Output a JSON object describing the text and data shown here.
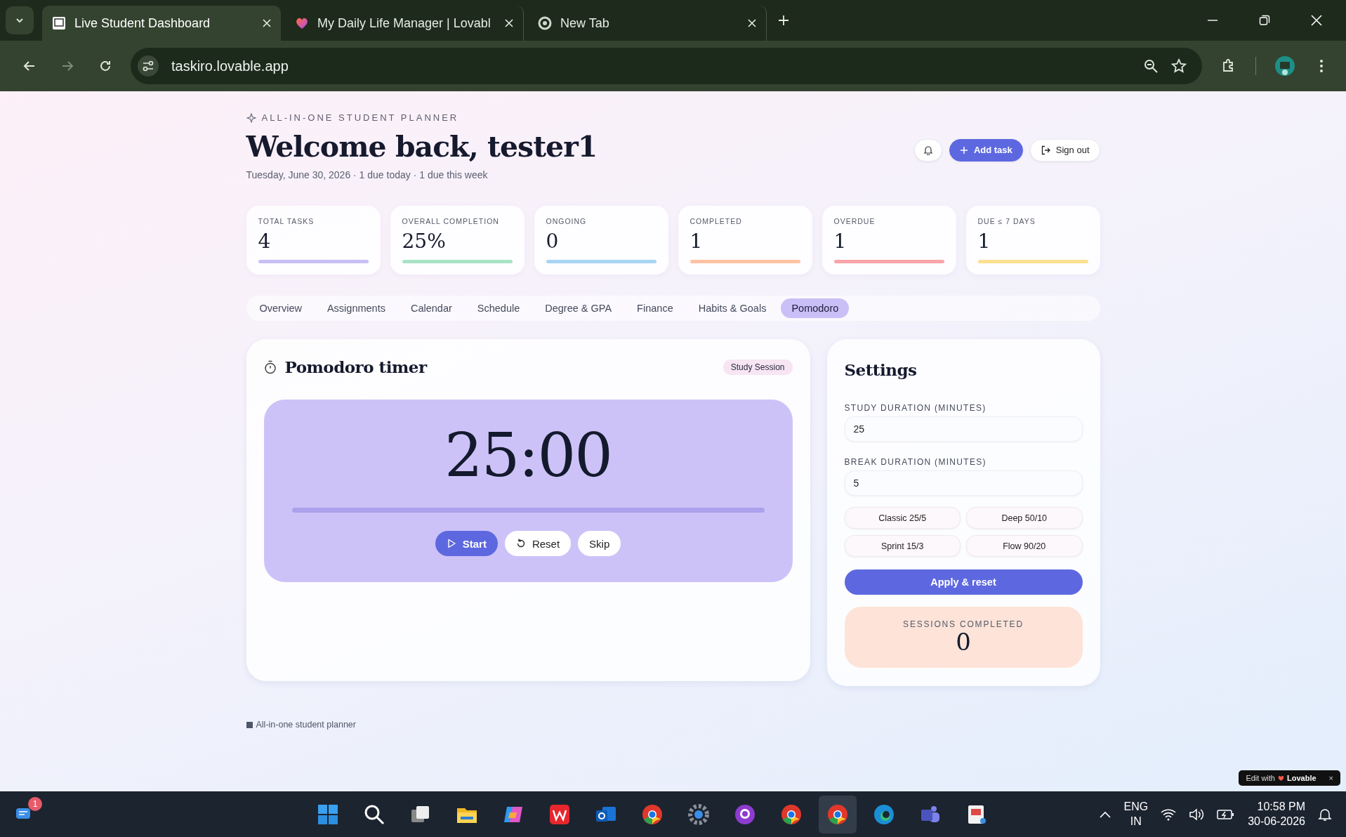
{
  "browser": {
    "tabs": [
      {
        "title": "Live Student Dashboard",
        "selected": true
      },
      {
        "title": "My Daily Life Manager | Lovabl",
        "selected": false
      },
      {
        "title": "New Tab",
        "selected": false
      }
    ],
    "url": "taskiro.lovable.app"
  },
  "header": {
    "eyebrow": "ALL-IN-ONE STUDENT PLANNER",
    "title": "Welcome back, tester1",
    "subtitle": "Tuesday, June 30, 2026 · 1 due today · 1 due this week",
    "buttons": [
      {
        "kind": "icon"
      },
      {
        "kind": "primary",
        "label": "Add task"
      },
      {
        "kind": "secondary",
        "label": "Sign out"
      }
    ]
  },
  "stats": [
    {
      "label": "TOTAL TASKS",
      "value": "4",
      "color": "#c9bff5"
    },
    {
      "label": "OVERALL COMPLETION",
      "value": "25%",
      "color": "#a8e3c5"
    },
    {
      "label": "ONGOING",
      "value": "0",
      "color": "#a9d5f5"
    },
    {
      "label": "COMPLETED",
      "value": "1",
      "color": "#ffc3a3"
    },
    {
      "label": "OVERDUE",
      "value": "1",
      "color": "#f8a4a8"
    },
    {
      "label": "DUE ≤ 7 DAYS",
      "value": "1",
      "color": "#fbe08f"
    }
  ],
  "nav_tabs": [
    {
      "label": "Overview",
      "selected": false
    },
    {
      "label": "Assignments",
      "selected": false
    },
    {
      "label": "Calendar",
      "selected": false
    },
    {
      "label": "Schedule",
      "selected": false
    },
    {
      "label": "Degree & GPA",
      "selected": false
    },
    {
      "label": "Finance",
      "selected": false
    },
    {
      "label": "Habits & Goals",
      "selected": false
    },
    {
      "label": "Pomodoro",
      "selected": true
    }
  ],
  "timer": {
    "title": "Pomodoro timer",
    "badge": "Study Session",
    "time": "25:00",
    "buttons": [
      {
        "kind": "primary",
        "label": "Start"
      },
      {
        "kind": "reset",
        "label": "Reset"
      },
      {
        "kind": "plain",
        "label": "Skip"
      }
    ]
  },
  "settings": {
    "title": "Settings",
    "fields": [
      {
        "label": "STUDY DURATION (MINUTES)",
        "value": "25"
      },
      {
        "label": "BREAK DURATION (MINUTES)",
        "value": "5"
      }
    ],
    "presets": [
      "Classic 25/5",
      "Deep 50/10",
      "Sprint 15/3",
      "Flow 90/20"
    ],
    "apply_button": "Apply & reset",
    "sessions": {
      "label": "SESSIONS COMPLETED",
      "value": "0"
    }
  },
  "footer": "All-in-one student planner",
  "edit_badge": {
    "prefix": "Edit with",
    "brand": "Lovable",
    "close": "×"
  },
  "taskbar": {
    "notification_count": "1",
    "apps": [
      {
        "selected": false
      },
      {
        "selected": false
      },
      {
        "selected": false
      },
      {
        "selected": false
      },
      {
        "selected": false
      },
      {
        "selected": false
      },
      {
        "selected": false
      },
      {
        "selected": false
      },
      {
        "selected": false
      },
      {
        "selected": false
      },
      {
        "selected": false
      },
      {
        "selected": true
      },
      {
        "selected": false
      },
      {
        "selected": false
      },
      {
        "selected": false
      }
    ],
    "language": "ENG",
    "region": "IN",
    "time": "10:58 PM",
    "date": "30-06-2026"
  }
}
